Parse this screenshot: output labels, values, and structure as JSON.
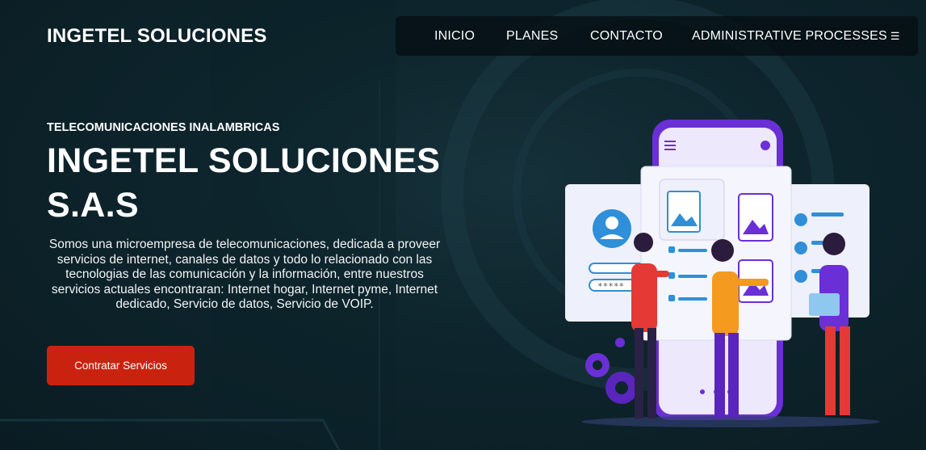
{
  "brand": {
    "logo_text": "INGETEL SOLUCIONES"
  },
  "nav": {
    "items": [
      "INICIO",
      "PLANES",
      "CONTACTO",
      "ADMINISTRATIVE PROCESSES"
    ],
    "menu_icon": "☰"
  },
  "hero": {
    "eyebrow": "TELECOMUNICACIONES INALAMBRICAS",
    "title": "INGETEL SOLUCIONES S.A.S",
    "description": "Somos una microempresa de telecomunicaciones, dedicada a proveer servicios de internet, canales de datos y todo lo relacionado con las tecnologias de las comunicación y la información, entre nuestros servicios actuales encontraran: Internet hogar, Internet pyme, Internet dedicado, Servicio de datos, Servicio de VOIP.",
    "cta_label": "Contratar Servicios"
  },
  "illustration": {
    "password_mask": "*****"
  },
  "colors": {
    "background": "#0e252d",
    "cta": "#c9230f",
    "phone": "#6b2fd6",
    "accent_blue": "#2f8fd8",
    "accent_orange": "#f39a1f",
    "accent_red": "#e53935"
  }
}
